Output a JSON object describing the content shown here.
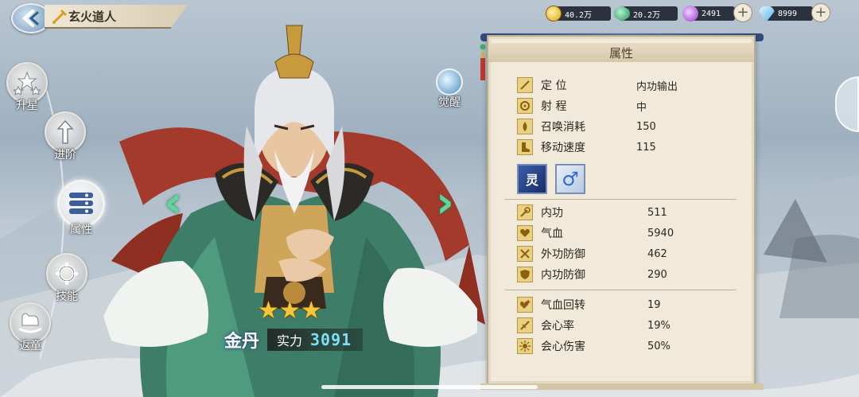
{
  "header": {
    "title": "玄火道人"
  },
  "currencies": [
    {
      "name": "gold",
      "value": "40.2万",
      "icon": "gold-coin-icon",
      "color": "#f2c438"
    },
    {
      "name": "jade",
      "value": "20.2万",
      "icon": "green-gem-icon",
      "color": "#2aa86e"
    },
    {
      "name": "crystal",
      "value": "2491",
      "icon": "purple-crystal-icon",
      "color": "#b66be0"
    },
    {
      "name": "diamond",
      "value": "8999",
      "icon": "diamond-icon",
      "color": "#6fc7f2"
    }
  ],
  "left_menu": [
    {
      "label": "升星",
      "icon": "stars-icon"
    },
    {
      "label": "进阶",
      "icon": "arrow-up-icon"
    },
    {
      "label": "属性",
      "icon": "list-icon",
      "active": true
    },
    {
      "label": "技能",
      "icon": "skill-gear-icon"
    },
    {
      "label": "返童",
      "icon": "rocking-horse-icon"
    }
  ],
  "character": {
    "awaken_label": "觉醒",
    "stars": 3,
    "rank": "金丹",
    "power_label": "实力",
    "power_value": "3091"
  },
  "panel": {
    "title": "属性",
    "basic": [
      {
        "label": "定 位",
        "value": "内功输出",
        "icon": "sword-icon"
      },
      {
        "label": "射 程",
        "value": "中",
        "icon": "target-icon"
      },
      {
        "label": "召唤消耗",
        "value": "150",
        "icon": "drop-icon"
      },
      {
        "label": "移动速度",
        "value": "115",
        "icon": "boot-icon"
      }
    ],
    "tags": [
      {
        "text": "灵",
        "icon": "spirit-badge-icon"
      },
      {
        "text": "♂",
        "icon": "male-icon"
      }
    ],
    "combat": [
      {
        "label": "内功",
        "value": "511",
        "icon": "staff-icon"
      },
      {
        "label": "气血",
        "value": "5940",
        "icon": "heart-icon"
      },
      {
        "label": "外功防御",
        "value": "462",
        "icon": "shield-swords-icon"
      },
      {
        "label": "内功防御",
        "value": "290",
        "icon": "shield-icon"
      }
    ],
    "special": [
      {
        "label": "气血回转",
        "value": "19",
        "icon": "heart-plus-icon"
      },
      {
        "label": "会心率",
        "value": "19%",
        "icon": "crit-sword-icon"
      },
      {
        "label": "会心伤害",
        "value": "50%",
        "icon": "burst-icon"
      }
    ]
  }
}
